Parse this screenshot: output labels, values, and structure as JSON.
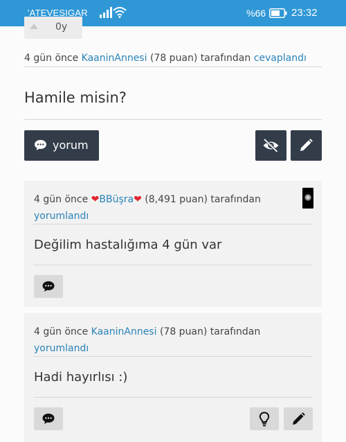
{
  "status_bar": {
    "carrier": "'ATEVESIGAR",
    "battery": "%66",
    "time": "23:32"
  },
  "previous_answer": {
    "vote_count": "0y",
    "meta": {
      "prefix": "4 gün önce ",
      "user": "KaaninAnnesi",
      "points": " (78 puan) tarafından ",
      "action": "cevaplandı"
    }
  },
  "answer": {
    "text": "Hamile misin?"
  },
  "actions": {
    "comment_label": "yorum",
    "comment_icon": "comment-icon",
    "hide_icon": "eye-slash-icon",
    "edit_icon": "pencil-icon"
  },
  "comments": [
    {
      "prefix": "4 gün önce ",
      "heart_left": "❤",
      "user": "BBüşra",
      "heart_right": "❤",
      "points": " (8,491 puan) tarafından",
      "action": "yorumlandı",
      "text": "Değilim hastalığıma 4 gün var"
    },
    {
      "prefix": "4 gün önce ",
      "user": "KaaninAnnesi",
      "points": " (78 puan) tarafından",
      "action": "yorumlandı",
      "text": "Hadi hayırlısı :)"
    }
  ],
  "colors": {
    "status_bar": "#2f97d6",
    "link": "#2a83b8",
    "dark_button": "#333d4a",
    "heart": "#e0262f"
  }
}
